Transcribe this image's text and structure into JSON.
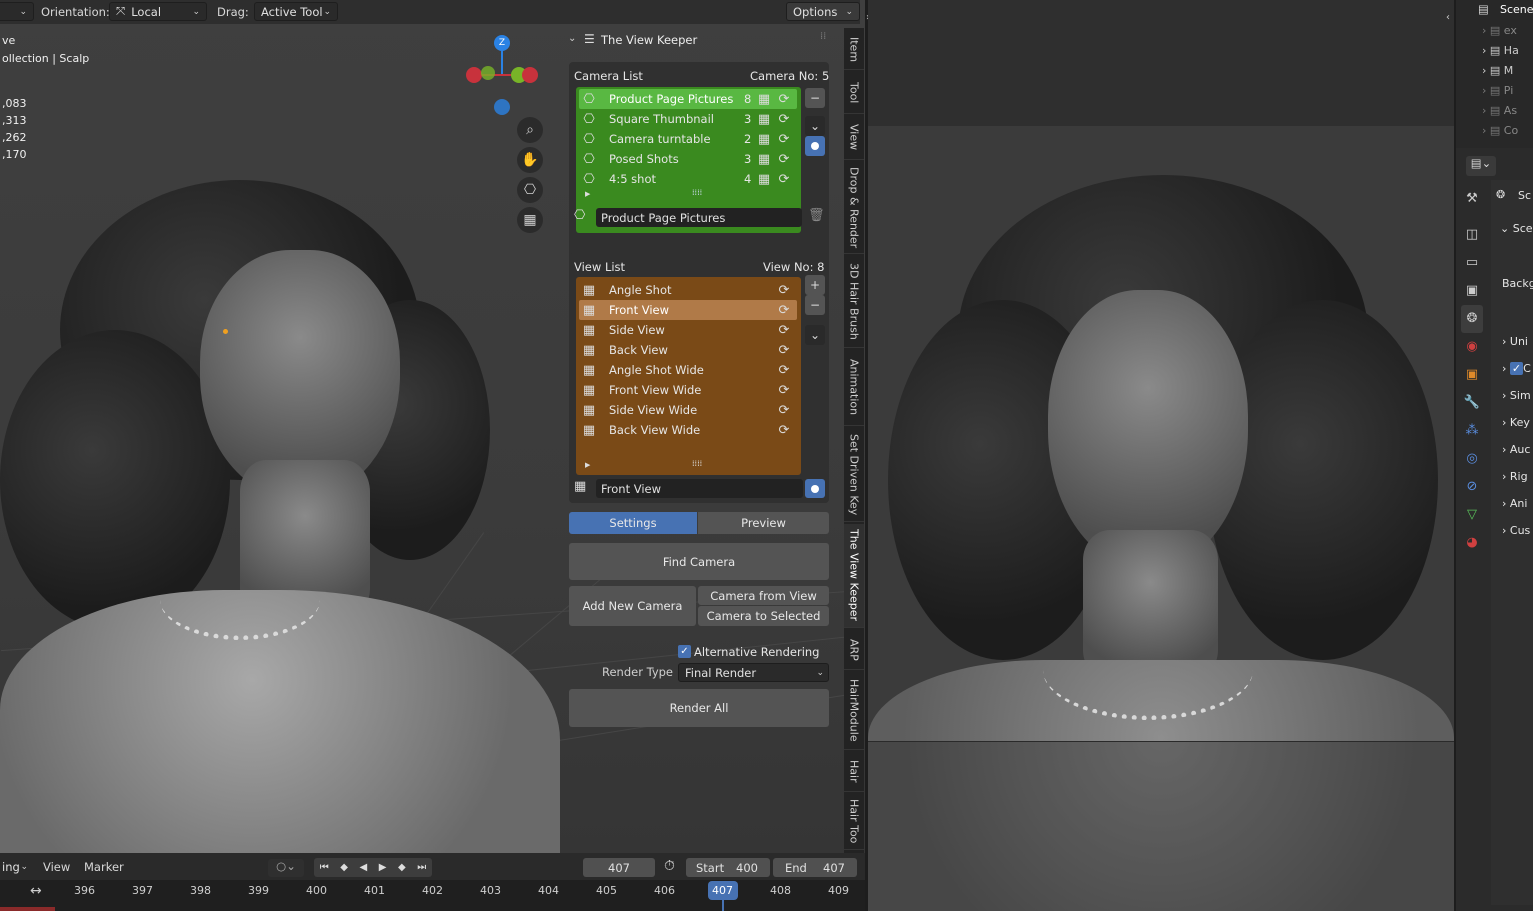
{
  "header": {
    "orientation_label": "Orientation:",
    "orientation_value": "Local",
    "drag_label": "Drag:",
    "drag_value": "Active Tool",
    "options_label": "Options"
  },
  "viewport_info": {
    "line1": "ve",
    "line2": "ollection | Scalp",
    "stats": [
      ",083",
      ",313",
      ",262",
      ",170"
    ]
  },
  "gizmo": {
    "z": "Z",
    "colors": {
      "x": "#c8323c",
      "y": "#78b428",
      "z": "#2a82e4"
    }
  },
  "panel": {
    "title": "The View Keeper",
    "camera_list": {
      "label": "Camera List",
      "count_label": "Camera No:  5",
      "items": [
        {
          "name": "Product Page Pictures",
          "count": "8"
        },
        {
          "name": "Square Thumbnail",
          "count": "3"
        },
        {
          "name": "Camera turntable",
          "count": "2"
        },
        {
          "name": "Posed Shots",
          "count": "3"
        },
        {
          "name": "4:5 shot",
          "count": "4"
        }
      ],
      "active": "Product Page Pictures"
    },
    "view_list": {
      "label": "View List",
      "count_label": "View No:  8",
      "items": [
        "Angle Shot",
        "Front View",
        "Side View",
        "Back View",
        "Angle Shot Wide",
        "Front View Wide",
        "Side View Wide",
        "Back View Wide"
      ],
      "active": "Front View"
    },
    "tabs": {
      "settings": "Settings",
      "preview": "Preview"
    },
    "buttons": {
      "find_camera": "Find Camera",
      "add_new_camera": "Add New Camera",
      "camera_from_view": "Camera from View",
      "camera_to_selected": "Camera to Selected",
      "render_all": "Render All"
    },
    "alt_rendering": "Alternative Rendering",
    "render_type_label": "Render Type",
    "render_type_value": "Final Render",
    "colors": {
      "camera_bg": "#3a8a1f",
      "camera_active": "#59b842",
      "view_bg": "#7a4a17",
      "view_active": "#b07a48",
      "accent": "#4772b3"
    }
  },
  "sidebar_tabs": [
    "Item",
    "Tool",
    "View",
    "Drop & Render",
    "3D Hair Brush",
    "Animation",
    "Set Driven Key",
    "The View Keeper",
    "ARP",
    "HairModule",
    "Hair",
    "Hair Too"
  ],
  "timeline": {
    "menu_left": "ing",
    "view": "View",
    "marker": "Marker",
    "current_frame": "407",
    "start_label": "Start",
    "start_value": "400",
    "end_label": "End",
    "end_value": "407",
    "ticks": [
      "396",
      "397",
      "398",
      "399",
      "400",
      "401",
      "402",
      "403",
      "404",
      "405",
      "406",
      "407",
      "408",
      "409"
    ]
  },
  "outliner": {
    "scene": "Scene",
    "items": [
      "ex",
      "Ha",
      "M",
      "Pi",
      "As",
      "Co"
    ]
  },
  "properties": {
    "items": [
      "Sc",
      "Sce",
      "Backg",
      "Uni",
      "C",
      "Sim",
      "Key",
      "Auc",
      "Rig",
      "Ani",
      "Cus"
    ]
  }
}
